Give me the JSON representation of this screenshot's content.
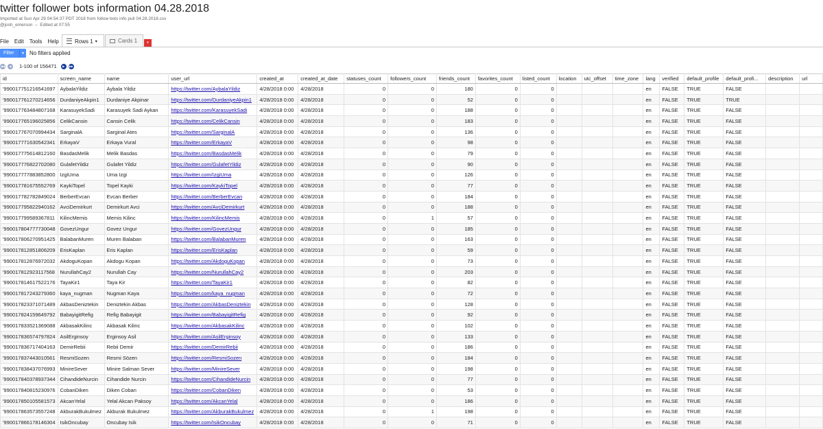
{
  "header": {
    "title": "twitter follower bots information 04.28.2018",
    "imported": "Imported at Sun Apr 29 04:54:37 PDT 2018 from follow bots info pull 04.28.2018.csv",
    "owner": "@josh_emerson",
    "edited": "Edited at 07:55"
  },
  "menu": [
    "File",
    "Edit",
    "Tools",
    "Help"
  ],
  "tabs": {
    "rows": "Rows 1",
    "cards": "Cards 1",
    "add": "+"
  },
  "filter": {
    "button": "Filter",
    "status": "No filters applied"
  },
  "pager": {
    "range": "1-100 of 156471"
  },
  "columns": [
    "id",
    "screen_name",
    "name",
    "user_url",
    "created_at",
    "created_at_date",
    "statuses_count",
    "followers_count",
    "friends_count",
    "favorites_count",
    "listed_count",
    "location",
    "utc_offset",
    "time_zone",
    "lang",
    "verified",
    "default_profile",
    "default_profi...",
    "description",
    "url"
  ],
  "rows": [
    [
      "'990017751216541697",
      "AybalaYildiz",
      "Aybala Yildiz",
      "https://twitter.com/AybalaYildiz",
      "4/28/2018 0:00",
      "4/28/2018",
      "0",
      "0",
      "180",
      "0",
      "0",
      "",
      "",
      "",
      "en",
      "FALSE",
      "TRUE",
      "FALSE",
      "",
      ""
    ],
    [
      "'990017761270214656",
      "DurdaniyeAkpin1",
      "Durdaniye Akpinar",
      "https://twitter.com/DurdaniyeAkpin1",
      "4/28/2018 0:00",
      "4/28/2018",
      "0",
      "0",
      "52",
      "0",
      "0",
      "",
      "",
      "",
      "en",
      "FALSE",
      "TRUE",
      "TRUE",
      "",
      ""
    ],
    [
      "'990017763484807168",
      "KarasuyekSadi",
      "Karasuyek Sadi Aykan",
      "https://twitter.com/KarasuyekSadi",
      "4/28/2018 0:00",
      "4/28/2018",
      "0",
      "0",
      "188",
      "0",
      "0",
      "",
      "",
      "",
      "en",
      "FALSE",
      "TRUE",
      "FALSE",
      "",
      ""
    ],
    [
      "'990017765196025856",
      "CelikCansin",
      "Cansin Celik",
      "https://twitter.com/CelikCansin",
      "4/28/2018 0:00",
      "4/28/2018",
      "0",
      "0",
      "183",
      "0",
      "0",
      "",
      "",
      "",
      "en",
      "FALSE",
      "TRUE",
      "FALSE",
      "",
      ""
    ],
    [
      "'990017767070994434",
      "SarginalA",
      "Sarginal Ates",
      "https://twitter.com/SarginalA",
      "4/28/2018 0:00",
      "4/28/2018",
      "0",
      "0",
      "136",
      "0",
      "0",
      "",
      "",
      "",
      "en",
      "FALSE",
      "TRUE",
      "FALSE",
      "",
      ""
    ],
    [
      "'990017771630542341",
      "ErkayaV",
      "Erkaya Vural",
      "https://twitter.com/ErkayaV",
      "4/28/2018 0:00",
      "4/28/2018",
      "0",
      "0",
      "98",
      "0",
      "0",
      "",
      "",
      "",
      "en",
      "FALSE",
      "TRUE",
      "FALSE",
      "",
      ""
    ],
    [
      "'990017775614812160",
      "BasdasMelik",
      "Melik Basdas",
      "https://twitter.com/BasdasMelik",
      "4/28/2018 0:00",
      "4/28/2018",
      "0",
      "0",
      "79",
      "0",
      "0",
      "",
      "",
      "",
      "en",
      "FALSE",
      "TRUE",
      "FALSE",
      "",
      ""
    ],
    [
      "'990017776822702080",
      "GulafetYildiz",
      "Gulafet Yildiz",
      "https://twitter.com/GulafetYildiz",
      "4/28/2018 0:00",
      "4/28/2018",
      "0",
      "0",
      "90",
      "0",
      "0",
      "",
      "",
      "",
      "en",
      "FALSE",
      "TRUE",
      "FALSE",
      "",
      ""
    ],
    [
      "'990017777883852800",
      "IzgiUma",
      "Uma Izgi",
      "https://twitter.com/IzgiUma",
      "4/28/2018 0:00",
      "4/28/2018",
      "0",
      "0",
      "126",
      "0",
      "0",
      "",
      "",
      "",
      "en",
      "FALSE",
      "TRUE",
      "FALSE",
      "",
      ""
    ],
    [
      "'990017781675552769",
      "KaykiTopel",
      "Topel Kayki",
      "https://twitter.com/KaykiTopel",
      "4/28/2018 0:00",
      "4/28/2018",
      "0",
      "0",
      "77",
      "0",
      "0",
      "",
      "",
      "",
      "en",
      "FALSE",
      "TRUE",
      "FALSE",
      "",
      ""
    ],
    [
      "'990017782782849024",
      "BerberEvcan",
      "Evcan Berber",
      "https://twitter.com/BerberEvcan",
      "4/28/2018 0:00",
      "4/28/2018",
      "0",
      "0",
      "184",
      "0",
      "0",
      "",
      "",
      "",
      "en",
      "FALSE",
      "TRUE",
      "FALSE",
      "",
      ""
    ],
    [
      "'990017795822940162",
      "AvciDemirkurt",
      "Demirkurt Avci",
      "https://twitter.com/AvciDemirkurt",
      "4/28/2018 0:00",
      "4/28/2018",
      "0",
      "0",
      "188",
      "0",
      "0",
      "",
      "",
      "",
      "en",
      "FALSE",
      "TRUE",
      "FALSE",
      "",
      ""
    ],
    [
      "'990017799589367811",
      "KilincMemis",
      "Memis Kilinc",
      "https://twitter.com/KilincMemis",
      "4/28/2018 0:00",
      "4/28/2018",
      "0",
      "1",
      "57",
      "0",
      "0",
      "",
      "",
      "",
      "en",
      "FALSE",
      "TRUE",
      "FALSE",
      "",
      ""
    ],
    [
      "'990017804777730048",
      "GovezUngur",
      "Govez Ungur",
      "https://twitter.com/GovezUngur",
      "4/28/2018 0:00",
      "4/28/2018",
      "0",
      "0",
      "185",
      "0",
      "0",
      "",
      "",
      "",
      "en",
      "FALSE",
      "TRUE",
      "FALSE",
      "",
      ""
    ],
    [
      "'990017806270951425",
      "BalabanMuren",
      "Muren Balaban",
      "https://twitter.com/BalabanMuren",
      "4/28/2018 0:00",
      "4/28/2018",
      "0",
      "0",
      "163",
      "0",
      "0",
      "",
      "",
      "",
      "en",
      "FALSE",
      "TRUE",
      "FALSE",
      "",
      ""
    ],
    [
      "'990017812851806209",
      "ErisKaplan",
      "Eris Kaplan",
      "https://twitter.com/ErisKaplan",
      "4/28/2018 0:00",
      "4/28/2018",
      "0",
      "0",
      "59",
      "0",
      "0",
      "",
      "",
      "",
      "en",
      "FALSE",
      "TRUE",
      "FALSE",
      "",
      ""
    ],
    [
      "'990017812876972032",
      "AkdoguKopan",
      "Akdogu Kopan",
      "https://twitter.com/AkdoguKopan",
      "4/28/2018 0:00",
      "4/28/2018",
      "0",
      "0",
      "73",
      "0",
      "0",
      "",
      "",
      "",
      "en",
      "FALSE",
      "TRUE",
      "FALSE",
      "",
      ""
    ],
    [
      "'990017812923117568",
      "NurullahCay2",
      "Nurullah Cay",
      "https://twitter.com/NurullahCay2",
      "4/28/2018 0:00",
      "4/28/2018",
      "0",
      "0",
      "203",
      "0",
      "0",
      "",
      "",
      "",
      "en",
      "FALSE",
      "TRUE",
      "FALSE",
      "",
      ""
    ],
    [
      "'990017814617522176",
      "TayaKir1",
      "Taya Kir",
      "https://twitter.com/TayaKir1",
      "4/28/2018 0:00",
      "4/28/2018",
      "0",
      "0",
      "82",
      "0",
      "0",
      "",
      "",
      "",
      "en",
      "FALSE",
      "TRUE",
      "FALSE",
      "",
      ""
    ],
    [
      "'990017817243279360",
      "kaya_nugman",
      "Nugman Kaya",
      "https://twitter.com/kaya_nugman",
      "4/28/2018 0:00",
      "4/28/2018",
      "0",
      "0",
      "72",
      "0",
      "0",
      "",
      "",
      "",
      "en",
      "FALSE",
      "TRUE",
      "FALSE",
      "",
      ""
    ],
    [
      "'990017823371071489",
      "AkbasDeniztekin",
      "Deniztekin Akbas",
      "https://twitter.com/AkbasDeniztekin",
      "4/28/2018 0:00",
      "4/28/2018",
      "0",
      "0",
      "128",
      "0",
      "0",
      "",
      "",
      "",
      "en",
      "FALSE",
      "TRUE",
      "FALSE",
      "",
      ""
    ],
    [
      "'990017824159649792",
      "BabayigitRefig",
      "Refig Babayigit",
      "https://twitter.com/BabayigitRefig",
      "4/28/2018 0:00",
      "4/28/2018",
      "0",
      "0",
      "92",
      "0",
      "0",
      "",
      "",
      "",
      "en",
      "FALSE",
      "TRUE",
      "FALSE",
      "",
      ""
    ],
    [
      "'990017833521369088",
      "AkbasakKilinc",
      "Akbasak Kilinc",
      "https://twitter.com/AkbasakKilinc",
      "4/28/2018 0:00",
      "4/28/2018",
      "0",
      "0",
      "102",
      "0",
      "0",
      "",
      "",
      "",
      "en",
      "FALSE",
      "TRUE",
      "FALSE",
      "",
      ""
    ],
    [
      "'990017836574797824",
      "AsilErginsoy",
      "Erginsoy Asil",
      "https://twitter.com/AsilErginsoy",
      "4/28/2018 0:00",
      "4/28/2018",
      "0",
      "0",
      "133",
      "0",
      "0",
      "",
      "",
      "",
      "en",
      "FALSE",
      "TRUE",
      "FALSE",
      "",
      ""
    ],
    [
      "'990017836717404163",
      "DemirRebii",
      "Rebii Demir",
      "https://twitter.com/DemirRebii",
      "4/28/2018 0:00",
      "4/28/2018",
      "0",
      "0",
      "186",
      "0",
      "0",
      "",
      "",
      "",
      "en",
      "FALSE",
      "TRUE",
      "FALSE",
      "",
      ""
    ],
    [
      "'990017837443010561",
      "ResmiSozen",
      "Resmi Sözen",
      "https://twitter.com/ResmiSozen",
      "4/28/2018 0:00",
      "4/28/2018",
      "0",
      "0",
      "184",
      "0",
      "0",
      "",
      "",
      "",
      "en",
      "FALSE",
      "TRUE",
      "FALSE",
      "",
      ""
    ],
    [
      "'990017838437076993",
      "MinireSever",
      "Minire Salman Sever",
      "https://twitter.com/MinireSever",
      "4/28/2018 0:00",
      "4/28/2018",
      "0",
      "0",
      "198",
      "0",
      "0",
      "",
      "",
      "",
      "en",
      "FALSE",
      "TRUE",
      "FALSE",
      "",
      ""
    ],
    [
      "'990017840378937344",
      "CihandideNurcin",
      "Cihandide Nurcin",
      "https://twitter.com/CihandideNurcin",
      "4/28/2018 0:00",
      "4/28/2018",
      "0",
      "0",
      "77",
      "0",
      "0",
      "",
      "",
      "",
      "en",
      "FALSE",
      "TRUE",
      "FALSE",
      "",
      ""
    ],
    [
      "'990017840815230976",
      "CobanDiken",
      "Diken Coban",
      "https://twitter.com/CobanDiken",
      "4/28/2018 0:00",
      "4/28/2018",
      "0",
      "0",
      "53",
      "0",
      "0",
      "",
      "",
      "",
      "en",
      "FALSE",
      "TRUE",
      "FALSE",
      "",
      ""
    ],
    [
      "'990017850105581573",
      "AkcanYelal",
      "Yelal Akcan Paksoy",
      "https://twitter.com/AkcanYelal",
      "4/28/2018 0:00",
      "4/28/2018",
      "0",
      "0",
      "186",
      "0",
      "0",
      "",
      "",
      "",
      "en",
      "FALSE",
      "TRUE",
      "FALSE",
      "",
      ""
    ],
    [
      "'990017863573557248",
      "AkburakBukulmez",
      "Akburak Bukulmez",
      "https://twitter.com/AkburakBukulmez",
      "4/28/2018 0:00",
      "4/28/2018",
      "0",
      "1",
      "198",
      "0",
      "0",
      "",
      "",
      "",
      "en",
      "FALSE",
      "TRUE",
      "FALSE",
      "",
      ""
    ],
    [
      "'990017866178146304",
      "IsikOncubay",
      "Oncubay Isik",
      "https://twitter.com/IsikOncubay",
      "4/28/2018 0:00",
      "4/28/2018",
      "0",
      "0",
      "71",
      "0",
      "0",
      "",
      "",
      "",
      "en",
      "FALSE",
      "TRUE",
      "FALSE",
      "",
      ""
    ]
  ]
}
